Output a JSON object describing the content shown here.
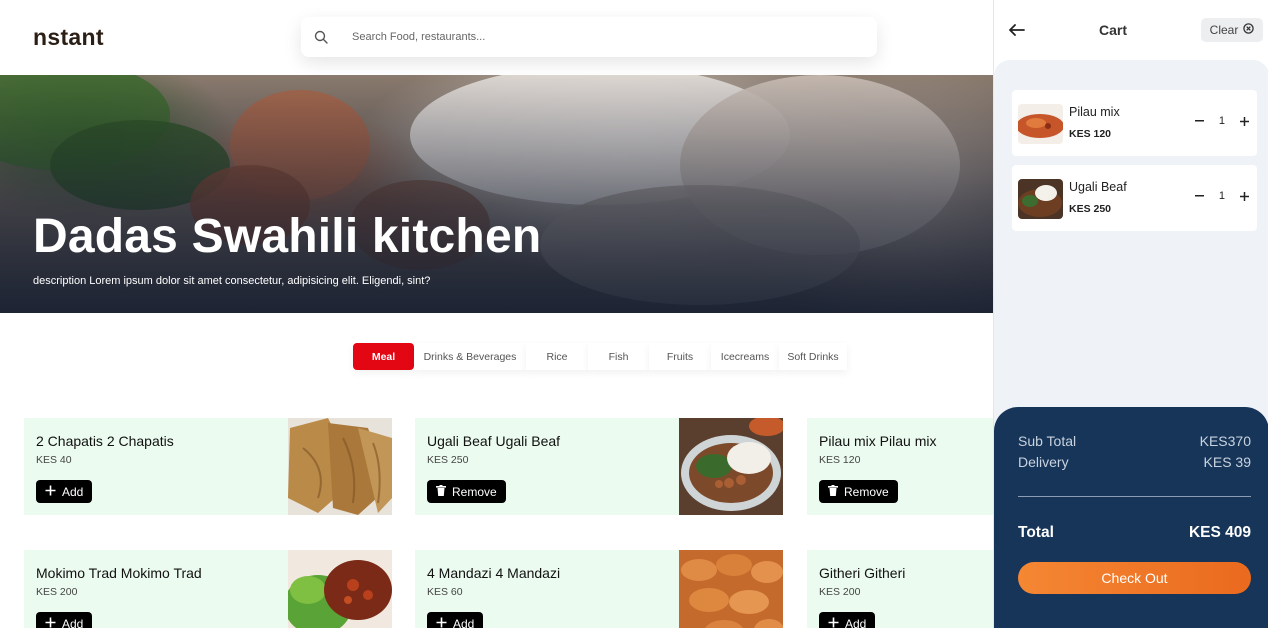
{
  "header": {
    "logo": "nstant",
    "search_placeholder": "Search Food, restaurants..."
  },
  "hero": {
    "title": "Dadas Swahili kitchen",
    "description": "description Lorem ipsum dolor sit amet consectetur, adipisicing elit. Eligendi, sint?"
  },
  "tabs": [
    {
      "label": "Meal",
      "active": true
    },
    {
      "label": "Drinks & Beverages",
      "active": false
    },
    {
      "label": "Rice",
      "active": false
    },
    {
      "label": "Fish",
      "active": false
    },
    {
      "label": "Fruits",
      "active": false
    },
    {
      "label": "Icecreams",
      "active": false
    },
    {
      "label": "Soft Drinks",
      "active": false
    }
  ],
  "menu_items": [
    {
      "name": "2 Chapatis 2 Chapatis",
      "price": "KES 40",
      "action": "Add"
    },
    {
      "name": "Ugali Beaf Ugali Beaf",
      "price": "KES 250",
      "action": "Remove"
    },
    {
      "name": "Pilau mix Pilau mix",
      "price": "KES 120",
      "action": "Remove"
    },
    {
      "name": "Mokimo Trad Mokimo Trad",
      "price": "KES 200",
      "action": "Add"
    },
    {
      "name": "4 Mandazi 4 Mandazi",
      "price": "KES 60",
      "action": "Add"
    },
    {
      "name": "Githeri Githeri",
      "price": "KES 200",
      "action": "Add"
    }
  ],
  "cart": {
    "title": "Cart",
    "clear_label": "Clear",
    "items": [
      {
        "name": "Pilau mix",
        "price": "KES 120",
        "qty": "1"
      },
      {
        "name": "Ugali Beaf",
        "price": "KES 250",
        "qty": "1"
      }
    ],
    "subtotal_label": "Sub Total",
    "subtotal_value": "KES370",
    "delivery_label": "Delivery",
    "delivery_value": "KES 39",
    "total_label": "Total",
    "total_value": "KES 409",
    "checkout_label": "Check Out"
  },
  "colors": {
    "accent_red": "#e30613",
    "cart_summary_bg": "#163559",
    "checkout_orange": "#f58733",
    "card_bg": "#ecfbf0"
  },
  "icons": {
    "search": "search-icon",
    "back": "arrow-left-icon",
    "clear": "close-circle-icon",
    "add": "plus-icon",
    "remove": "trash-icon",
    "minus": "minus-icon",
    "plus": "plus-icon"
  }
}
